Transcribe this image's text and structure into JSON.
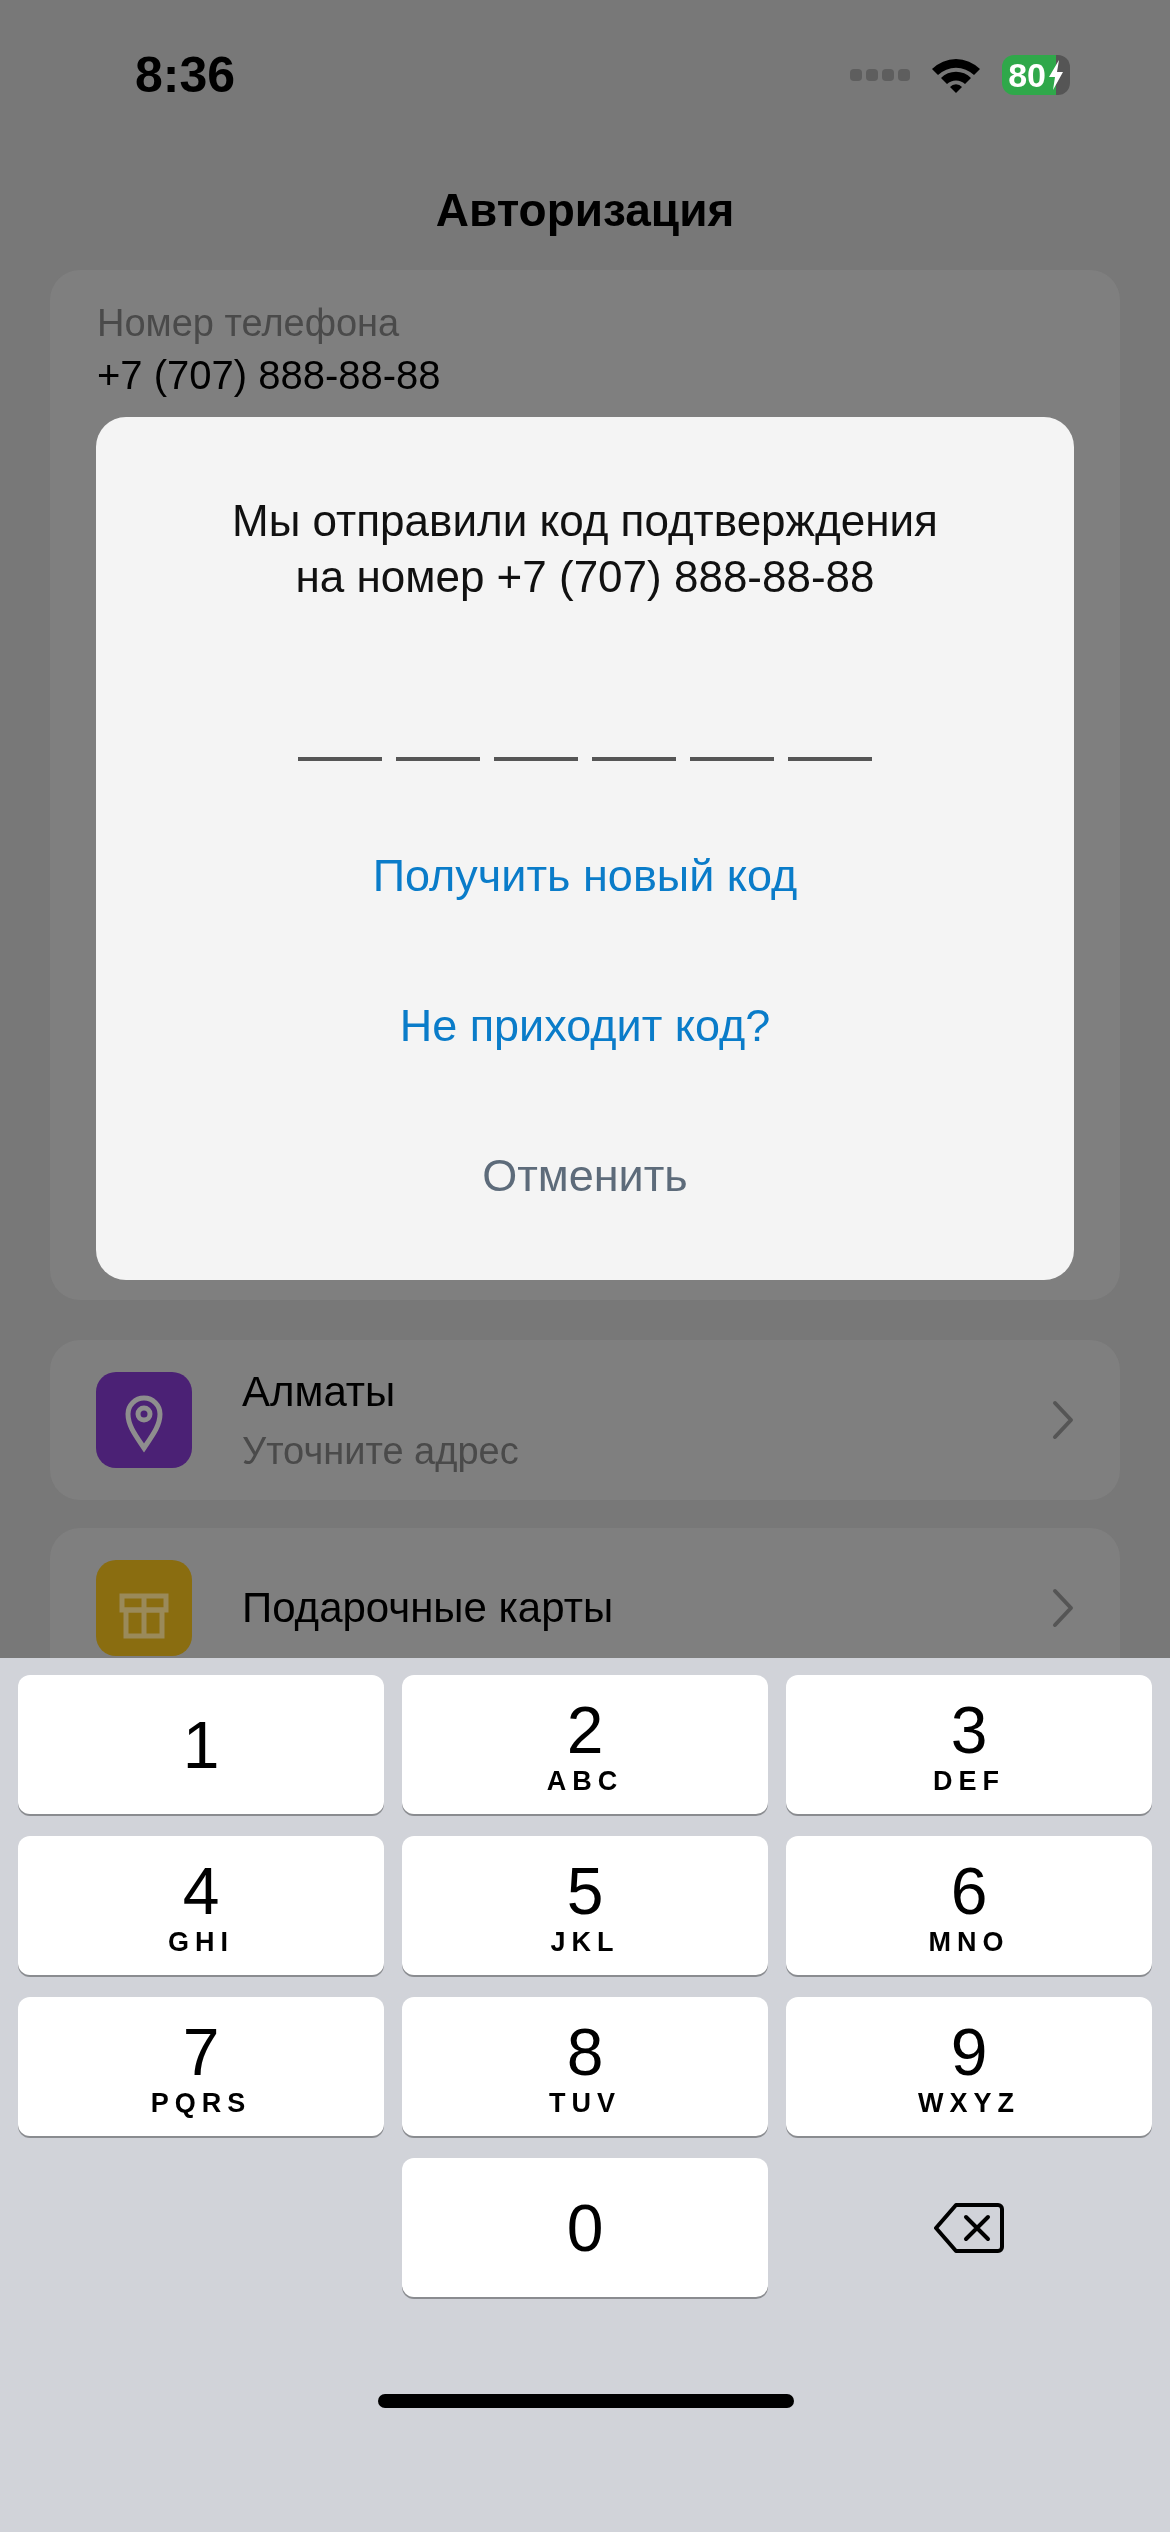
{
  "status_bar": {
    "time": "8:36",
    "battery": "80"
  },
  "title": "Авторизация",
  "phone_field": {
    "label": "Номер телефона",
    "value": "+7 (707) 888-88-88"
  },
  "menu": [
    {
      "kind": "location",
      "title": "Алматы",
      "subtitle": "Уточните адрес"
    },
    {
      "kind": "gift",
      "title": "Подарочные карты"
    }
  ],
  "dialog": {
    "message_lines": [
      "Мы отправили код подтверждения",
      "на номер +7 (707) 888-88-88"
    ],
    "code_slots": [
      {
        "filled": false
      },
      {
        "filled": false
      },
      {
        "filled": false
      },
      {
        "filled": false
      },
      {
        "filled": false
      },
      {
        "filled": false
      }
    ],
    "actions": [
      {
        "kind": "link",
        "label": "Получить новый код"
      },
      {
        "kind": "link",
        "label": "Не приходит код?"
      },
      {
        "kind": "cancel",
        "label": "Отменить"
      }
    ]
  },
  "keypad": [
    {
      "kind": "digit",
      "digit": "1"
    },
    {
      "kind": "digit",
      "digit": "2",
      "letters": "ABC"
    },
    {
      "kind": "digit",
      "digit": "3",
      "letters": "DEF"
    },
    {
      "kind": "digit",
      "digit": "4",
      "letters": "GHI"
    },
    {
      "kind": "digit",
      "digit": "5",
      "letters": "JKL"
    },
    {
      "kind": "digit",
      "digit": "6",
      "letters": "MNO"
    },
    {
      "kind": "digit",
      "digit": "7",
      "letters": "PQRS"
    },
    {
      "kind": "digit",
      "digit": "8",
      "letters": "TUV"
    },
    {
      "kind": "digit",
      "digit": "9",
      "letters": "WXYZ"
    },
    {
      "kind": "blank"
    },
    {
      "kind": "digit",
      "digit": "0"
    },
    {
      "kind": "delete"
    }
  ]
}
